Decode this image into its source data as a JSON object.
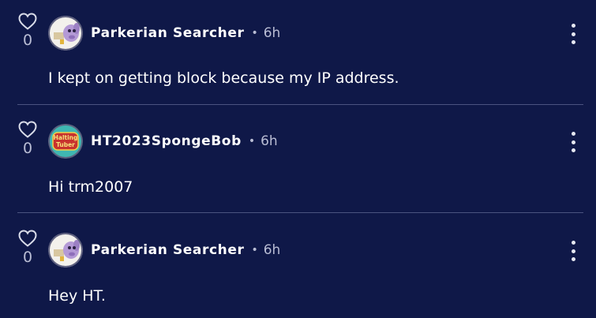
{
  "comments": [
    {
      "likes": "0",
      "username": "Parkerian Searcher",
      "separator": "•",
      "time": "6h",
      "text": "I kept on getting block because my IP address.",
      "avatar": "purple-character-avatar"
    },
    {
      "likes": "0",
      "username": "HT2023SpongeBob",
      "separator": "•",
      "time": "6h",
      "text": "Hi trm2007",
      "avatar": "halting-tuber-logo-avatar",
      "avatar_text_line1": "Halting",
      "avatar_text_line2": "Tuber"
    },
    {
      "likes": "0",
      "username": "Parkerian Searcher",
      "separator": "•",
      "time": "6h",
      "text": "Hey HT.",
      "avatar": "purple-character-avatar"
    }
  ],
  "colors": {
    "background": "#0f1848",
    "divider": "#4b5380",
    "muted_text": "#b9bdd4",
    "primary_text": "#ffffff"
  },
  "icons": {
    "like": "heart-outline-icon",
    "more": "kebab-menu-icon"
  }
}
